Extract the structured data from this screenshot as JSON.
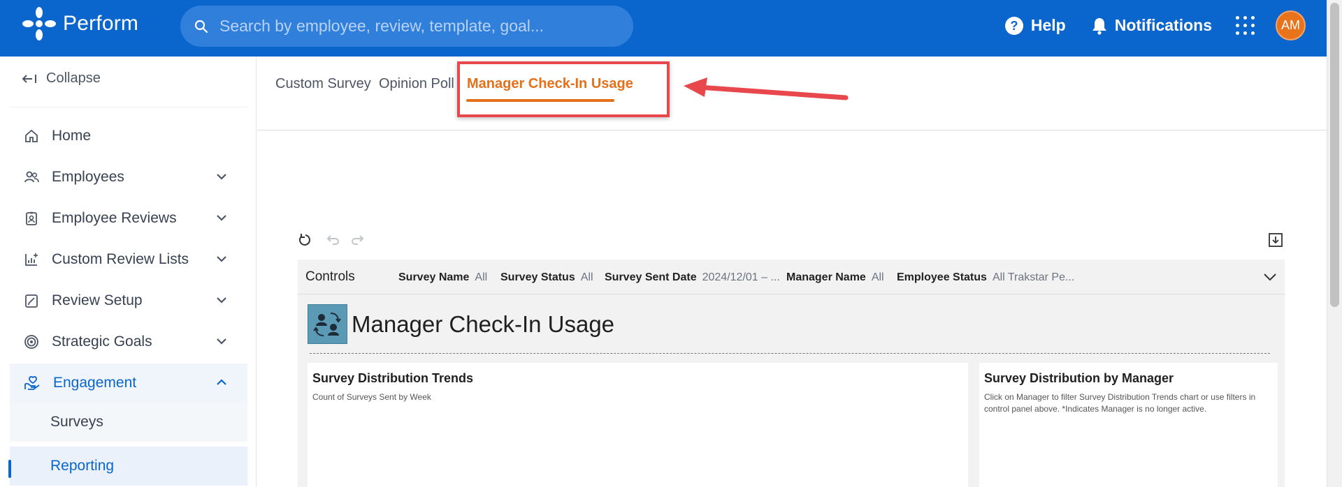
{
  "app": {
    "name": "Perform"
  },
  "search": {
    "placeholder": "Search by employee, review, template, goal..."
  },
  "header": {
    "help_label": "Help",
    "notifications_label": "Notifications",
    "avatar_initials": "AM"
  },
  "sidebar": {
    "collapse_label": "Collapse",
    "items": [
      {
        "label": "Home",
        "icon": "home-icon"
      },
      {
        "label": "Employees",
        "icon": "people-icon"
      },
      {
        "label": "Employee Reviews",
        "icon": "badge-icon"
      },
      {
        "label": "Custom Review Lists",
        "icon": "chart-add-icon"
      },
      {
        "label": "Review Setup",
        "icon": "clipboard-edit-icon"
      },
      {
        "label": "Strategic Goals",
        "icon": "target-icon"
      },
      {
        "label": "Engagement",
        "icon": "hand-heart-icon"
      }
    ],
    "subitems": [
      {
        "label": "Surveys"
      },
      {
        "label": "Reporting"
      }
    ]
  },
  "tabs": [
    {
      "label": "Custom Survey"
    },
    {
      "label": "Opinion Poll"
    },
    {
      "label": "Manager Check-In Usage"
    }
  ],
  "controls": {
    "title": "Controls",
    "filters": [
      {
        "name": "Survey Name",
        "value": "All"
      },
      {
        "name": "Survey Status",
        "value": "All"
      },
      {
        "name": "Survey Sent Date",
        "value": "2024/12/01 – ..."
      },
      {
        "name": "Manager Name",
        "value": "All"
      },
      {
        "name": "Employee Status",
        "value": "All Trakstar Pe..."
      }
    ]
  },
  "report": {
    "title": "Manager Check-In Usage",
    "cards": [
      {
        "title": "Survey Distribution Trends",
        "subtitle": "Count of Surveys Sent by Week"
      },
      {
        "title": "Survey Distribution by Manager",
        "subtitle": "Click on Manager to filter Survey Distribution Trends chart or use filters in control panel above. *Indicates Manager is no longer active."
      }
    ]
  },
  "colors": {
    "brand_blue": "#0a66cc",
    "active_tab": "#e3711c",
    "annotation_red": "#e8474c",
    "avatar": "#e8731a"
  }
}
